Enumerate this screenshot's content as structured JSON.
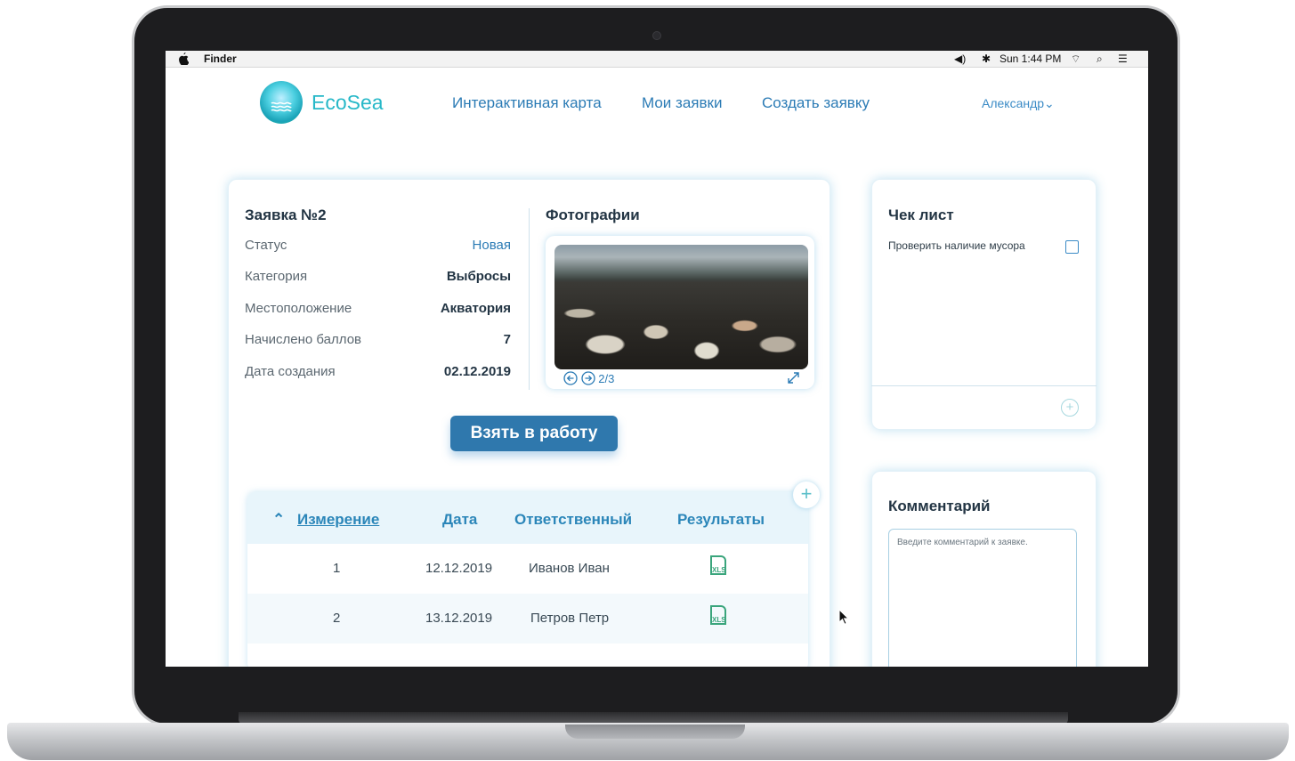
{
  "menubar": {
    "apple": "",
    "app": "Finder",
    "volume": "◀)",
    "bluetooth": "✱",
    "time": "Sun 1:44 PM",
    "wifi": "⌔",
    "search": "⌕",
    "list": "☰"
  },
  "header": {
    "brand": "EcoSea",
    "nav": [
      "Интерактивная карта",
      "Мои заявки",
      "Создать заявку"
    ],
    "user": "Александр⌄"
  },
  "request": {
    "title": "Заявка №2",
    "fields": [
      {
        "label": "Статус",
        "value": "Новая"
      },
      {
        "label": "Категория",
        "value": "Выбросы"
      },
      {
        "label": "Местоположение",
        "value": "Акватория"
      },
      {
        "label": "Начислено баллов",
        "value": "7"
      },
      {
        "label": "Дата создания",
        "value": "02.12.2019"
      }
    ],
    "take_button": "Взять в работу"
  },
  "photos": {
    "title": "Фотографии",
    "prev": "⊖",
    "next": "⊕",
    "counter": "2/3",
    "expand": "⤢"
  },
  "measurements": {
    "add": "+",
    "headers": [
      "⌃",
      "Измерение",
      "Дата",
      "Ответственный",
      "Результаты"
    ],
    "rows": [
      {
        "n": "1",
        "date": "12.12.2019",
        "who": "Иванов Иван",
        "file": "XLS"
      },
      {
        "n": "2",
        "date": "13.12.2019",
        "who": "Петров Петр",
        "file": "XLS"
      }
    ]
  },
  "checklist": {
    "title": "Чек лист",
    "items": [
      "Проверить наличие мусора"
    ],
    "add": "+"
  },
  "comment": {
    "title": "Комментарий",
    "placeholder": "Введите комментарий к заявке."
  },
  "colors": {
    "accent": "#2b7bb5",
    "brand": "#27b8c8",
    "button": "#2f78ad"
  },
  "icons": [
    "apple-icon",
    "volume-icon",
    "bluetooth-icon",
    "wifi-icon",
    "search-icon",
    "list-icon",
    "logo-icon",
    "chevron-down-icon",
    "arrow-left-icon",
    "arrow-right-icon",
    "expand-icon",
    "plus-icon",
    "xls-file-icon",
    "chevron-up-icon",
    "checkbox-icon",
    "cursor-icon"
  ]
}
